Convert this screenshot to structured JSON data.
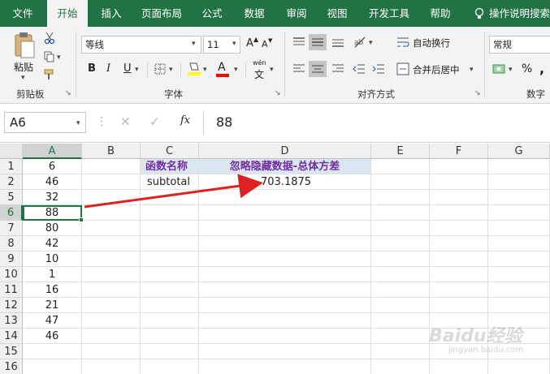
{
  "tabs": [
    "文件",
    "开始",
    "插入",
    "页面布局",
    "公式",
    "数据",
    "审阅",
    "视图",
    "开发工具",
    "帮助",
    "操作说明搜索"
  ],
  "active_tab": "开始",
  "ribbon": {
    "clipboard": {
      "paste_label": "粘贴",
      "group_label": "剪贴板"
    },
    "font": {
      "font_name": "等线",
      "font_size": "11",
      "grow_label": "A",
      "shrink_label": "A",
      "bold": "B",
      "italic": "I",
      "underline": "U",
      "font_color_label": "A",
      "phonetic_label": "wén",
      "phonetic_char": "文",
      "group_label": "字体"
    },
    "alignment": {
      "wrap_text": "自动换行",
      "merge_center": "合并后居中",
      "group_label": "对齐方式"
    },
    "number": {
      "format": "常规",
      "percent": "%",
      "comma": ",",
      "group_label": "数字"
    }
  },
  "formula_bar": {
    "name_box": "A6",
    "fx": "fx",
    "content": "88"
  },
  "columns": [
    "A",
    "B",
    "C",
    "D",
    "E",
    "F",
    "G"
  ],
  "rows": [
    "1",
    "2",
    "5",
    "6",
    "7",
    "8",
    "9",
    "10",
    "11",
    "12",
    "13",
    "14",
    "15",
    "16"
  ],
  "column_a_values": [
    "6",
    "46",
    "32",
    "88",
    "80",
    "42",
    "10",
    "1",
    "16",
    "21",
    "47",
    "46",
    "",
    ""
  ],
  "c1_header": "函数名称",
  "d1_header": "忽略隐藏数据-总体方差",
  "c2_value": "subtotal",
  "d2_value": "703.1875",
  "colors": {
    "brand": "#217346",
    "header_text": "#7030a0",
    "header_fill": "#dce6f1",
    "arrow": "#e02020",
    "selection": "#217346"
  },
  "watermark": {
    "text": "Baidu经验",
    "url": "jingyan.baidu.com"
  }
}
